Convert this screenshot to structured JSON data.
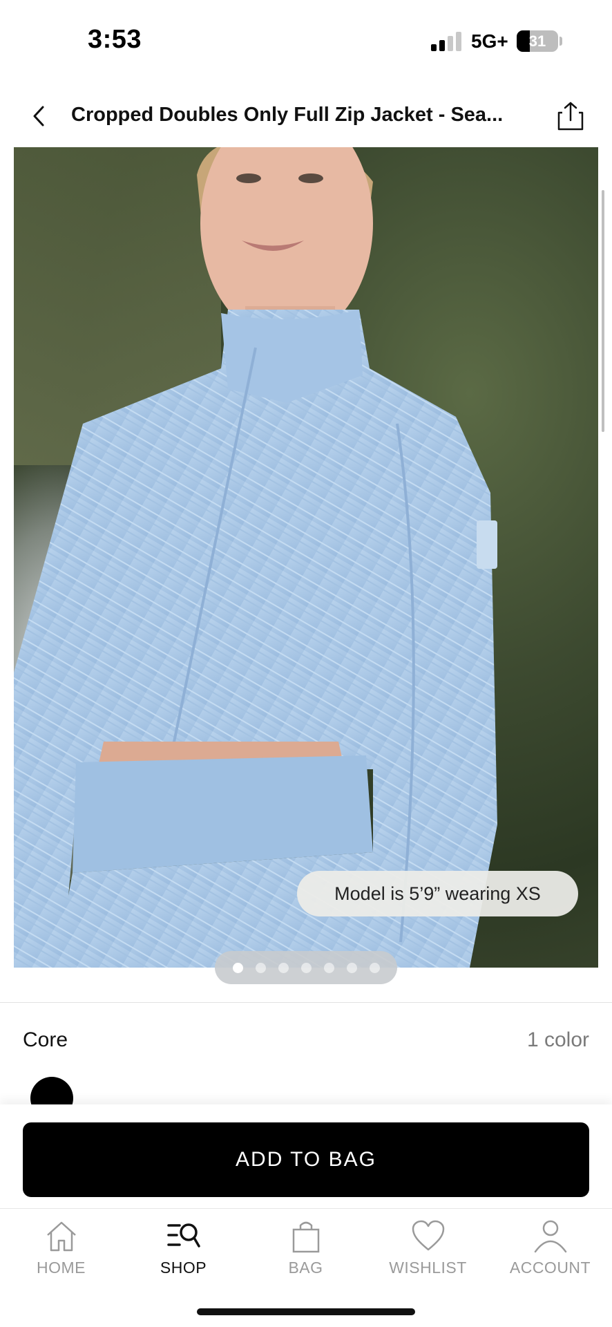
{
  "status_bar": {
    "time": "3:53",
    "network": "5G+",
    "battery_level": "31"
  },
  "header": {
    "back_icon": "chevron-left-icon",
    "title": "Cropped Doubles Only Full Zip Jacket - Sea...",
    "share_icon": "share-icon"
  },
  "gallery": {
    "model_info": "Model is 5’9” wearing XS",
    "image_count": 7,
    "active_index": 0
  },
  "colors": {
    "collection": "Core",
    "count_label": "1 color",
    "swatches": [
      {
        "name": "black",
        "color": "#000000"
      }
    ]
  },
  "cta": {
    "add_to_bag": "ADD TO BAG"
  },
  "tabbar": {
    "tabs": [
      {
        "label": "HOME",
        "icon": "home-icon",
        "active": false
      },
      {
        "label": "SHOP",
        "icon": "shop-search-icon",
        "active": true
      },
      {
        "label": "BAG",
        "icon": "bag-icon",
        "active": false
      },
      {
        "label": "WISHLIST",
        "icon": "heart-icon",
        "active": false
      },
      {
        "label": "ACCOUNT",
        "icon": "account-icon",
        "active": false
      }
    ]
  },
  "theme": {
    "primary": "#000000",
    "muted_text": "#9a9a9a",
    "jacket_color": "#a9c6e4"
  }
}
